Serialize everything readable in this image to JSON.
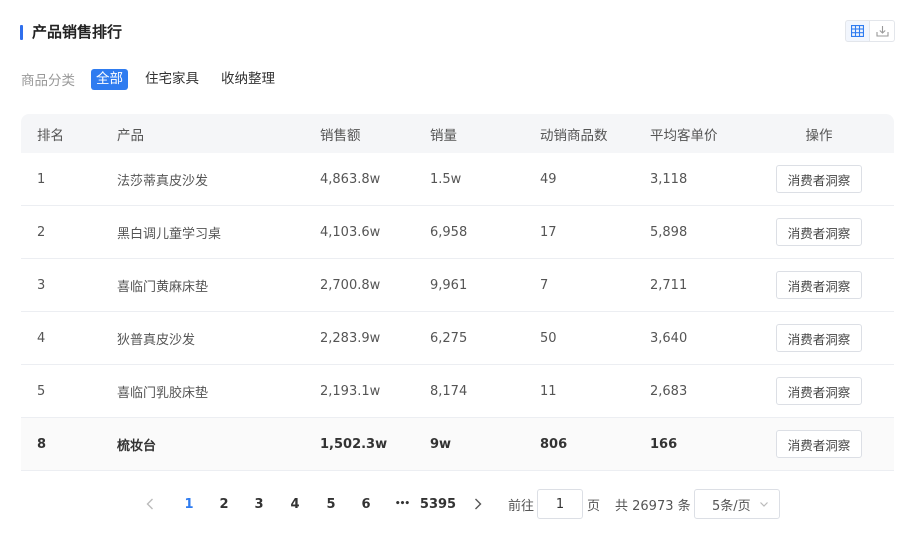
{
  "header": {
    "title": "产品销售排行"
  },
  "filter": {
    "label": "商品分类",
    "chips": [
      "全部",
      "住宅家具",
      "收纳整理"
    ],
    "active_index": 0
  },
  "table": {
    "columns": [
      "排名",
      "产品",
      "销售额",
      "销量",
      "动销商品数",
      "平均客单价",
      "操作"
    ],
    "rows": [
      {
        "rank": "1",
        "product": "法莎蒂真皮沙发",
        "sales": "4,863.8w",
        "volume": "1.5w",
        "active_items": "49",
        "avg_price": "3,118",
        "action": "消费者洞察"
      },
      {
        "rank": "2",
        "product": "黑白调儿童学习桌",
        "sales": "4,103.6w",
        "volume": "6,958",
        "active_items": "17",
        "avg_price": "5,898",
        "action": "消费者洞察"
      },
      {
        "rank": "3",
        "product": "喜临门黄麻床垫",
        "sales": "2,700.8w",
        "volume": "9,961",
        "active_items": "7",
        "avg_price": "2,711",
        "action": "消费者洞察"
      },
      {
        "rank": "4",
        "product": "狄普真皮沙发",
        "sales": "2,283.9w",
        "volume": "6,275",
        "active_items": "50",
        "avg_price": "3,640",
        "action": "消费者洞察"
      },
      {
        "rank": "5",
        "product": "喜临门乳胶床垫",
        "sales": "2,193.1w",
        "volume": "8,174",
        "active_items": "11",
        "avg_price": "2,683",
        "action": "消费者洞察"
      }
    ],
    "pinned_row": {
      "rank": "8",
      "product": "梳妆台",
      "sales": "1,502.3w",
      "volume": "9w",
      "active_items": "806",
      "avg_price": "166",
      "action": "消费者洞察"
    }
  },
  "pagination": {
    "pages": [
      "1",
      "2",
      "3",
      "4",
      "5",
      "6"
    ],
    "ellipsis": "•••",
    "last_page": "5395",
    "current": "1",
    "goto_label": "前往",
    "goto_value": "1",
    "page_unit": "页",
    "total_text": "共 26973 条",
    "page_size": "5条/页"
  },
  "colors": {
    "accent": "#2f7cf0",
    "title_bar": "#2f6fed"
  }
}
